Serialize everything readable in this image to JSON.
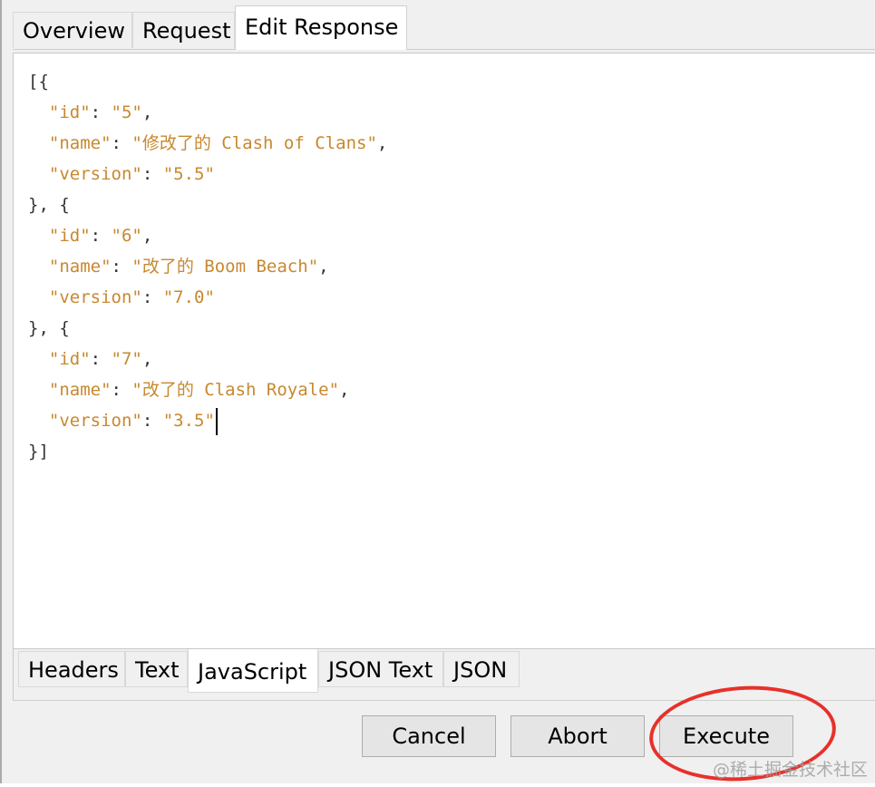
{
  "top_tabs": {
    "overview": "Overview",
    "request": "Request",
    "edit_response": "Edit Response"
  },
  "editor": {
    "lines": [
      {
        "p1": "[{"
      },
      {
        "indent": "  ",
        "key": "\"id\"",
        "sep": ": ",
        "value": "\"5\"",
        "end": ","
      },
      {
        "indent": "  ",
        "key": "\"name\"",
        "sep": ": ",
        "value": "\"修改了的 Clash of Clans\"",
        "end": ","
      },
      {
        "indent": "  ",
        "key": "\"version\"",
        "sep": ": ",
        "value": "\"5.5\"",
        "end": ""
      },
      {
        "p1": "}, {"
      },
      {
        "indent": "  ",
        "key": "\"id\"",
        "sep": ": ",
        "value": "\"6\"",
        "end": ","
      },
      {
        "indent": "  ",
        "key": "\"name\"",
        "sep": ": ",
        "value": "\"改了的 Boom Beach\"",
        "end": ","
      },
      {
        "indent": "  ",
        "key": "\"version\"",
        "sep": ": ",
        "value": "\"7.0\"",
        "end": ""
      },
      {
        "p1": "}, {"
      },
      {
        "indent": "  ",
        "key": "\"id\"",
        "sep": ": ",
        "value": "\"7\"",
        "end": ","
      },
      {
        "indent": "  ",
        "key": "\"name\"",
        "sep": ": ",
        "value": "\"改了的 Clash Royale\"",
        "end": ","
      },
      {
        "indent": "  ",
        "key": "\"version\"",
        "sep": ": ",
        "value": "\"3.5\"",
        "end": ""
      },
      {
        "p1": "}]"
      }
    ]
  },
  "bottom_tabs": {
    "headers": "Headers",
    "text": "Text",
    "javascript": "JavaScript",
    "json_text": "JSON Text",
    "json": "JSON"
  },
  "buttons": {
    "cancel": "Cancel",
    "abort": "Abort",
    "execute": "Execute"
  },
  "colors": {
    "json_token": "#c8882f",
    "annotation": "#e8302a"
  },
  "watermark": "@稀土掘金技术社区"
}
